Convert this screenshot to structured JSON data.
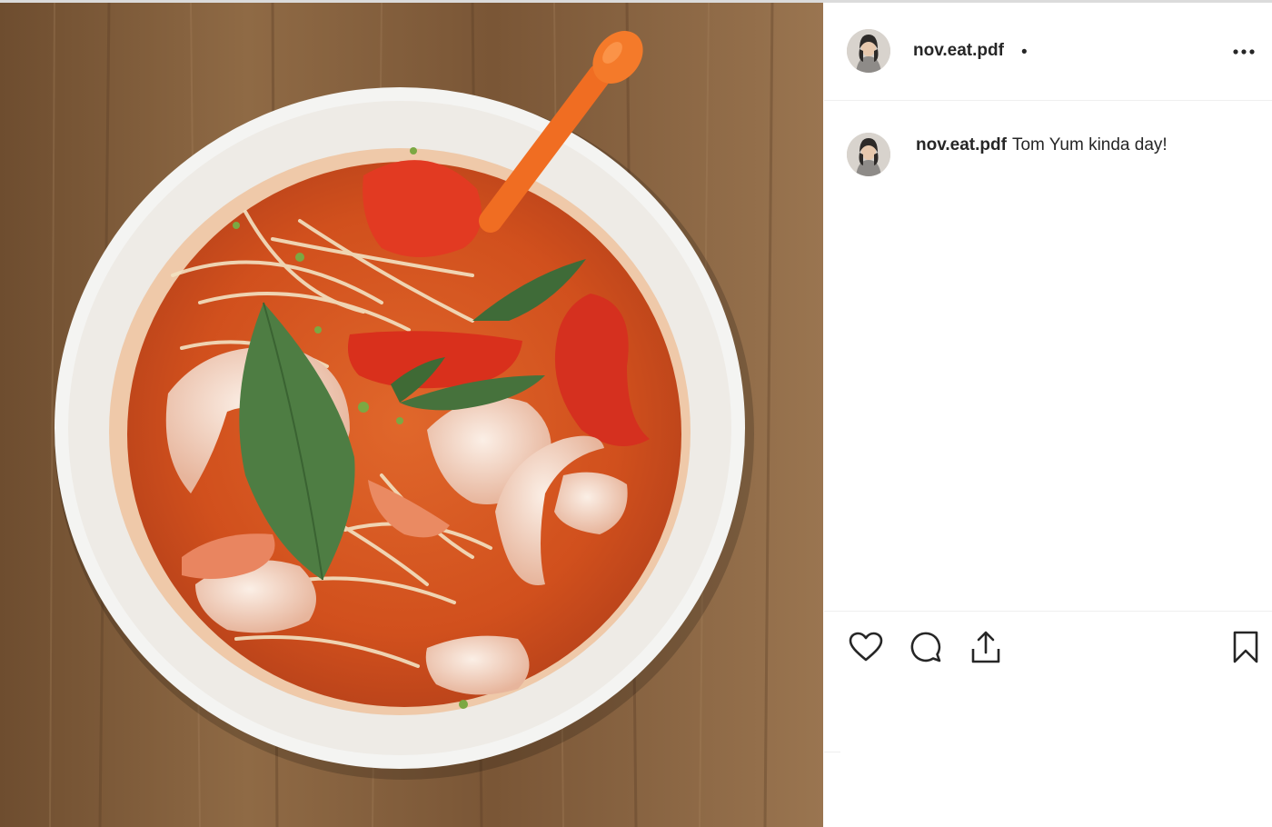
{
  "post": {
    "username": "nov.eat.pdf",
    "header_separator": "•",
    "caption_username": "nov.eat.pdf",
    "caption": "Tom Yum kinda day!",
    "media_icon": "food-photo-tom-yum-soup"
  },
  "header": {
    "options_icon": "more-options-icon"
  },
  "actions": {
    "like_icon": "heart-icon",
    "comment_icon": "comment-icon",
    "share_icon": "share-icon",
    "save_icon": "bookmark-icon"
  },
  "colors": {
    "text": "#262626",
    "divider": "#efefef",
    "broth": "#d9541f",
    "wood": "#8a6440"
  }
}
